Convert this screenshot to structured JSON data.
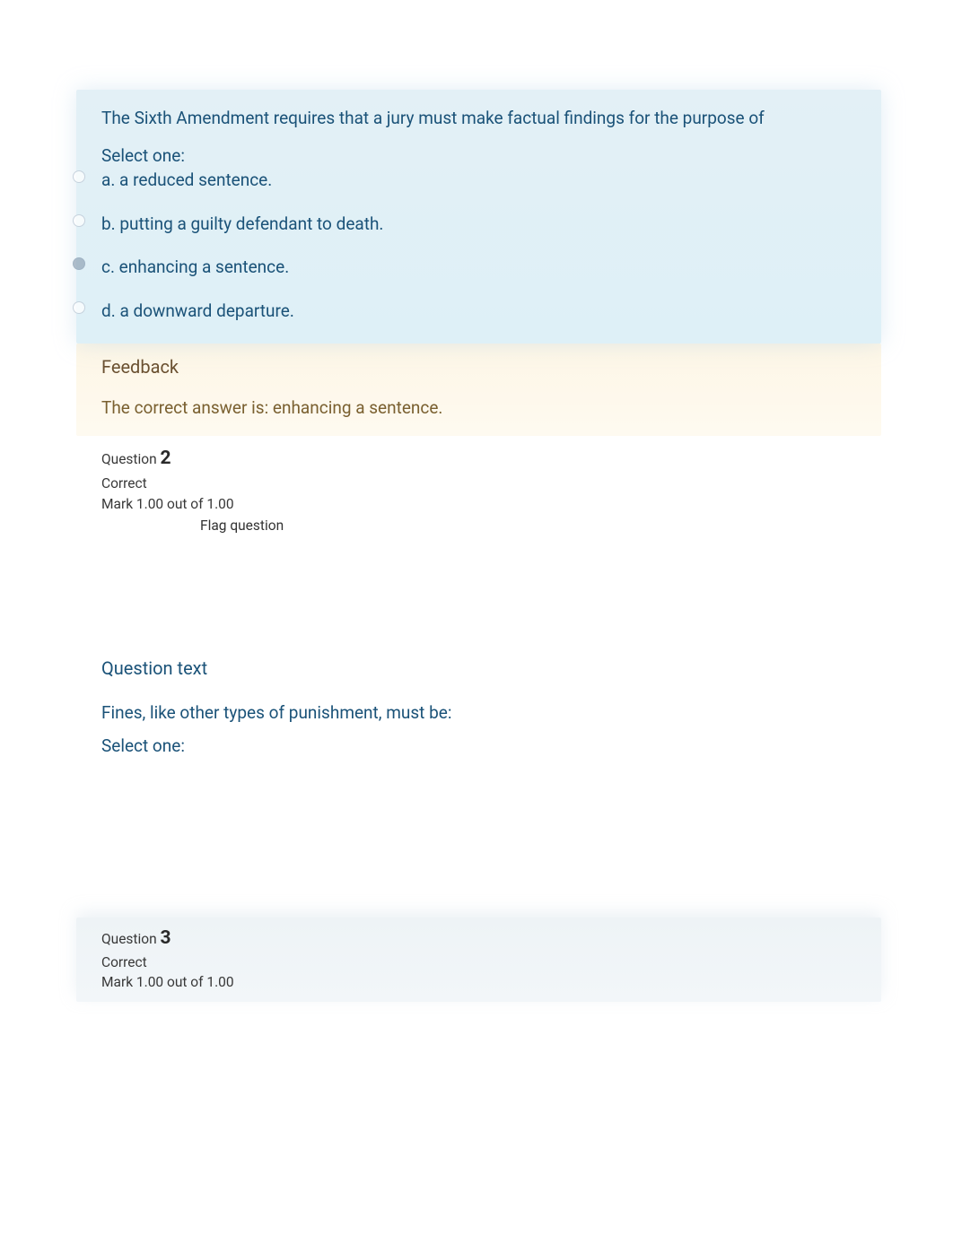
{
  "q1": {
    "prompt": "The Sixth Amendment requires that a jury must make factual findings for the purpose of",
    "select_label": "Select one:",
    "options": {
      "a": "a. a reduced sentence.",
      "b": "b. putting a guilty defendant to death.",
      "c": "c. enhancing a sentence.",
      "d": "d. a downward departure."
    },
    "feedback_title": "Feedback",
    "feedback_text": "The correct answer is: enhancing a sentence."
  },
  "q2header": {
    "label": "Question ",
    "number": "2",
    "status": "Correct",
    "mark": "Mark 1.00 out of 1.00",
    "flag": "Flag question"
  },
  "q2body": {
    "qt_label": "Question text",
    "prompt": "Fines, like other types of punishment, must be:",
    "select_label": "Select one:"
  },
  "q3header": {
    "label": "Question ",
    "number": "3",
    "status": "Correct",
    "mark": "Mark 1.00 out of 1.00"
  }
}
